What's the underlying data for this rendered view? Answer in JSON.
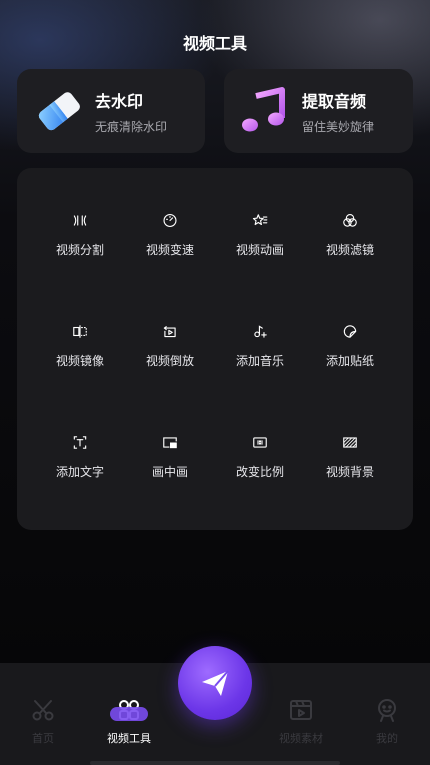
{
  "header": {
    "title": "视频工具"
  },
  "cards": [
    {
      "title": "去水印",
      "subtitle": "无痕清除水印",
      "icon": "eraser-icon"
    },
    {
      "title": "提取音频",
      "subtitle": "留住美妙旋律",
      "icon": "music-note-icon"
    }
  ],
  "tools": [
    {
      "label": "视频分割",
      "icon": "split-icon"
    },
    {
      "label": "视频变速",
      "icon": "speedometer-icon"
    },
    {
      "label": "视频动画",
      "icon": "star-animation-icon"
    },
    {
      "label": "视频滤镜",
      "icon": "filter-icon"
    },
    {
      "label": "视频镜像",
      "icon": "mirror-icon"
    },
    {
      "label": "视频倒放",
      "icon": "reverse-play-icon"
    },
    {
      "label": "添加音乐",
      "icon": "music-add-icon"
    },
    {
      "label": "添加贴纸",
      "icon": "sticker-icon"
    },
    {
      "label": "添加文字",
      "icon": "text-icon"
    },
    {
      "label": "画中画",
      "icon": "picture-in-picture-icon"
    },
    {
      "label": "改变比例",
      "icon": "aspect-ratio-icon"
    },
    {
      "label": "视频背景",
      "icon": "background-icon"
    }
  ],
  "tabbar": {
    "tabs": [
      {
        "label": "首页",
        "icon": "scissors-icon",
        "active": false
      },
      {
        "label": "视频工具",
        "icon": "grid-tools-icon",
        "active": true
      },
      {
        "label": "视频素材",
        "icon": "video-material-icon",
        "active": false
      },
      {
        "label": "我的",
        "icon": "profile-icon",
        "active": false
      }
    ],
    "fab_icon": "send-plane-icon"
  },
  "colors": {
    "accent": "#7a4cf0",
    "card_bg": "#1e1e22",
    "panel_bg": "#1b1b1e",
    "tabbar_bg": "#19191c",
    "inactive_tab_text": "#3a3a3f"
  }
}
